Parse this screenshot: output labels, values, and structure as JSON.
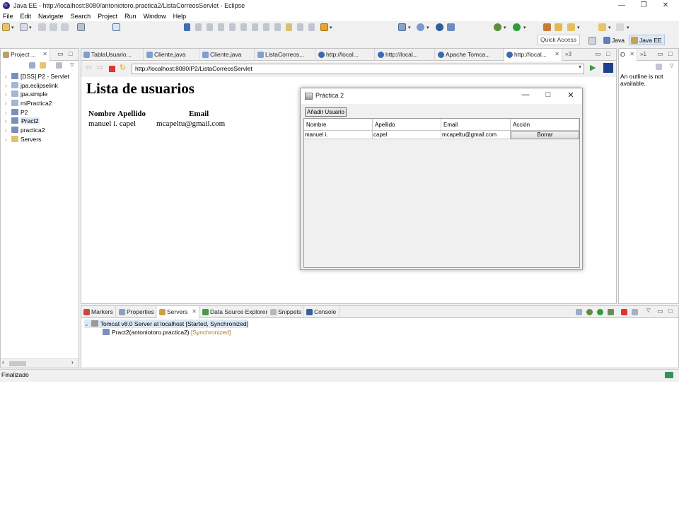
{
  "window": {
    "title": "Java EE - http://localhost:8080/antoniotoro.practica2/ListaCorreosServlet - Eclipse",
    "minimize": "—",
    "restore": "❐",
    "close": "✕"
  },
  "menu": [
    "File",
    "Edit",
    "Navigate",
    "Search",
    "Project",
    "Run",
    "Window",
    "Help"
  ],
  "toolbar": {
    "quick_access": "Quick Access",
    "perspectives": [
      "Java",
      "Java EE"
    ]
  },
  "project_explorer": {
    "title": "Project ...",
    "items": [
      "[DSS] P2 - Servlet",
      "jpa.eclipselink",
      "jpa.simple",
      "miPractica2",
      "P2",
      "Pract2",
      "practica2",
      "Servers"
    ],
    "selected": "Pract2"
  },
  "editor_tabs": [
    "TablaUsuario...",
    "Cliente.java",
    "Cliente.java",
    "ListaCorreos...",
    "http://local...",
    "http://local...",
    "Apache Tomca...",
    "http://local..."
  ],
  "editor_overflow": "»3",
  "browser": {
    "url": "http://localhost:8080/P2/ListaCorreosServlet",
    "heading": "Lista de usuarios",
    "columns": [
      "Nombre",
      "Apellido",
      "Email"
    ],
    "rows": [
      [
        "manuel i.",
        "capel",
        "mcapeltu@gmail.com"
      ]
    ]
  },
  "dialog": {
    "title": "Práctica 2",
    "add_button": "Añadir Usuario",
    "columns": [
      "Nombre",
      "Apellido",
      "Email",
      "Acción"
    ],
    "rows": [
      [
        "manuel i.",
        "capel",
        "mcapeltu@gmail.com",
        "Borrar"
      ]
    ]
  },
  "outline": {
    "tab": "O",
    "overflow": "»1",
    "message": "An outline is not available."
  },
  "bottom_tabs": [
    "Markers",
    "Properties",
    "Servers",
    "Data Source Explorer",
    "Snippets",
    "Console"
  ],
  "servers": {
    "server": "Tomcat v8.0 Server at localhost  [Started, Synchronized]",
    "module": "Pract2(antoniotoro.practica2)",
    "module_status": "[Synchronized]"
  },
  "status": "Finalizado"
}
